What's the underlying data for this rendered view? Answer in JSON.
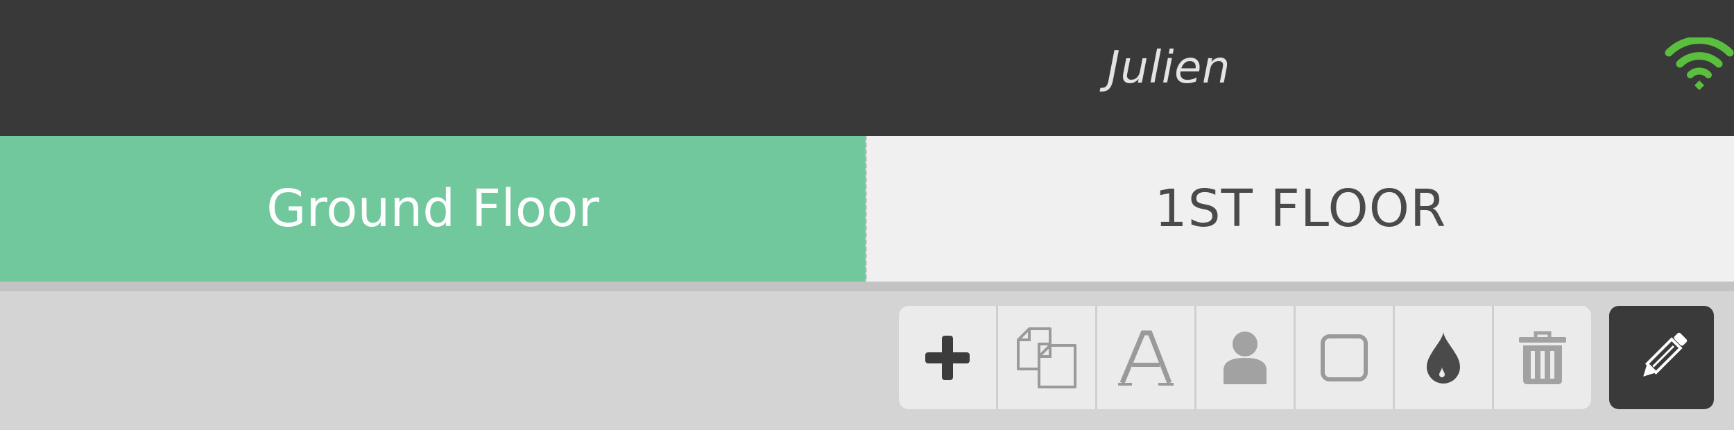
{
  "header": {
    "title": "Julien",
    "wifi_icon": "wifi-icon",
    "wifi_color": "#5bbf3e",
    "background": "#393939"
  },
  "tabs": [
    {
      "label": "Ground Floor",
      "active": true,
      "color": "#71c89d"
    },
    {
      "label": "1ST FLOOR",
      "active": false,
      "color": "#f1f0f1"
    }
  ],
  "toolbar": {
    "tools": [
      {
        "name": "add",
        "icon": "plus-icon"
      },
      {
        "name": "duplicate",
        "icon": "copy-icon"
      },
      {
        "name": "text",
        "icon": "text-font-icon"
      },
      {
        "name": "user",
        "icon": "user-icon"
      },
      {
        "name": "shape",
        "icon": "rounded-square-icon"
      },
      {
        "name": "color",
        "icon": "drop-icon"
      },
      {
        "name": "delete",
        "icon": "trash-icon"
      }
    ],
    "edit": {
      "icon": "pencil-icon",
      "active": true
    }
  }
}
